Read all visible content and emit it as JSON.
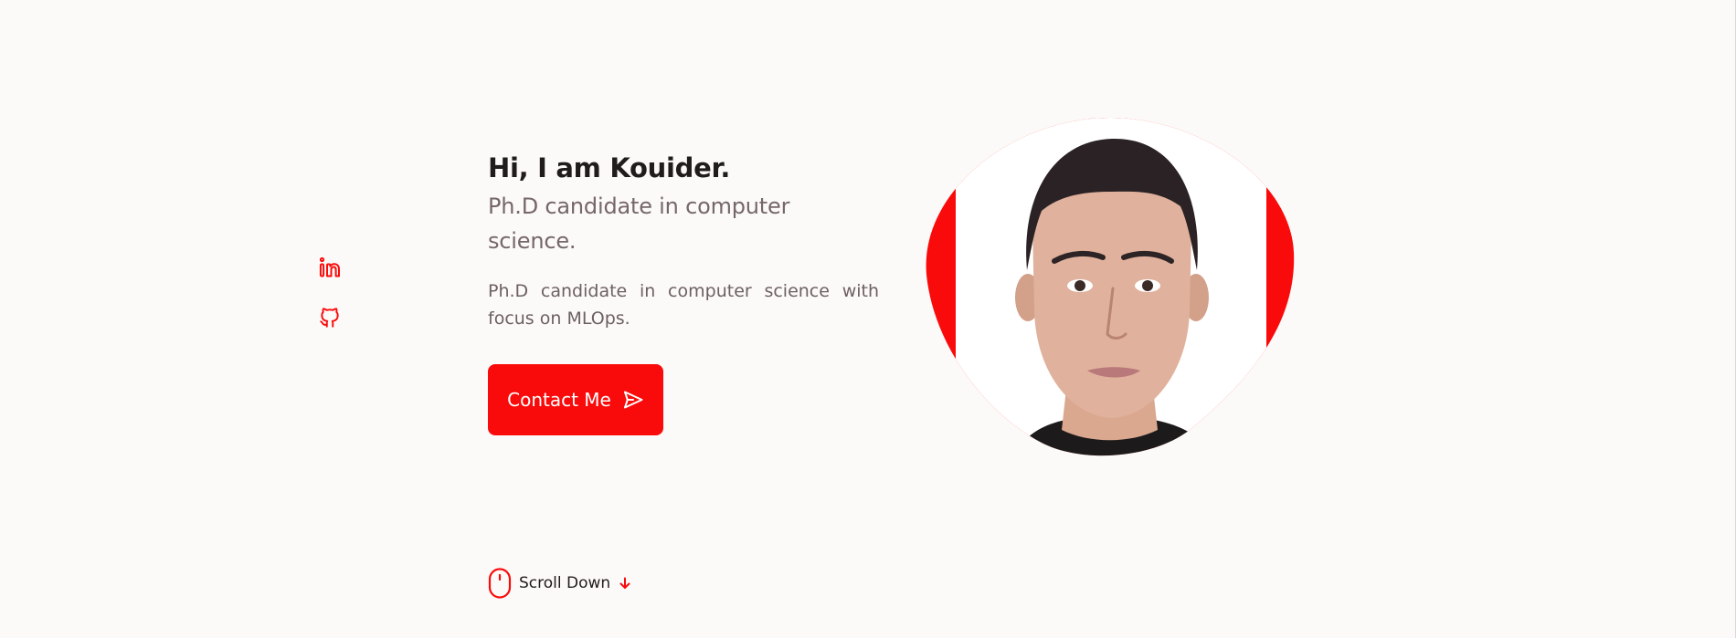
{
  "hero": {
    "title": "Hi, I am Kouider.",
    "subtitle": "Ph.D candidate in computer science.",
    "description": "Ph.D candidate in computer science with focus on MLOps.",
    "contact_label": "Contact Me"
  },
  "social": {
    "items": [
      {
        "icon": "linkedin-icon"
      },
      {
        "icon": "github-icon"
      }
    ]
  },
  "scroll": {
    "label": "Scroll Down"
  },
  "colors": {
    "accent": "#fa0b0b",
    "background": "#fcfaf8",
    "title": "#201c1c",
    "subtitle": "#76676a"
  }
}
